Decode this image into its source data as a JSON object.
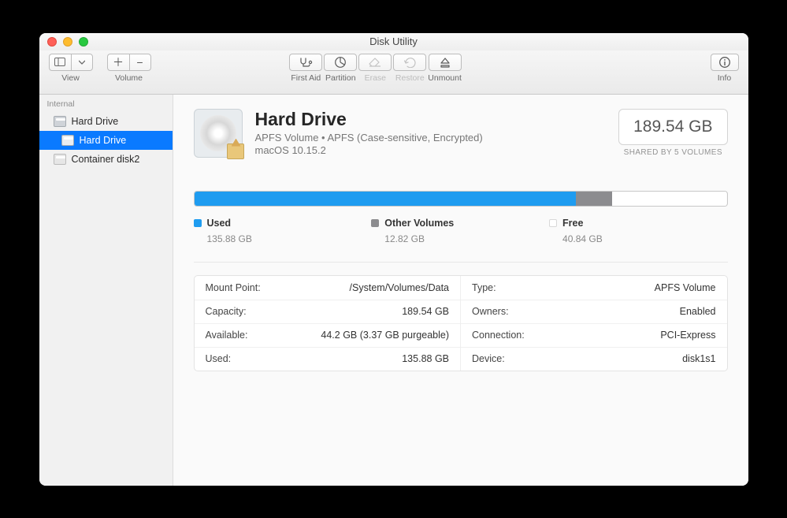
{
  "window": {
    "title": "Disk Utility"
  },
  "toolbar": {
    "view": "View",
    "volume": "Volume",
    "first_aid": "First Aid",
    "partition": "Partition",
    "erase": "Erase",
    "restore": "Restore",
    "unmount": "Unmount",
    "info": "Info"
  },
  "sidebar": {
    "heading": "Internal",
    "items": [
      {
        "label": "Hard Drive",
        "selected": false
      },
      {
        "label": "Hard Drive",
        "selected": true
      },
      {
        "label": "Container disk2",
        "selected": false
      }
    ]
  },
  "volume": {
    "name": "Hard Drive",
    "subtitle": "APFS Volume • APFS (Case-sensitive, Encrypted)",
    "os_line": "macOS 10.15.2",
    "capacity_box": "189.54 GB",
    "shared_text": "SHARED BY 5 VOLUMES"
  },
  "usage": {
    "used_label": "Used",
    "used_value": "135.88 GB",
    "used_pct": 71.7,
    "other_label": "Other Volumes",
    "other_value": "12.82 GB",
    "other_pct": 6.8,
    "free_label": "Free",
    "free_value": "40.84 GB",
    "free_pct": 21.5
  },
  "details": {
    "left": [
      {
        "k": "Mount Point:",
        "v": "/System/Volumes/Data"
      },
      {
        "k": "Capacity:",
        "v": "189.54 GB"
      },
      {
        "k": "Available:",
        "v": "44.2 GB (3.37 GB purgeable)"
      },
      {
        "k": "Used:",
        "v": "135.88 GB"
      }
    ],
    "right": [
      {
        "k": "Type:",
        "v": "APFS Volume"
      },
      {
        "k": "Owners:",
        "v": "Enabled"
      },
      {
        "k": "Connection:",
        "v": "PCI-Express"
      },
      {
        "k": "Device:",
        "v": "disk1s1"
      }
    ]
  }
}
